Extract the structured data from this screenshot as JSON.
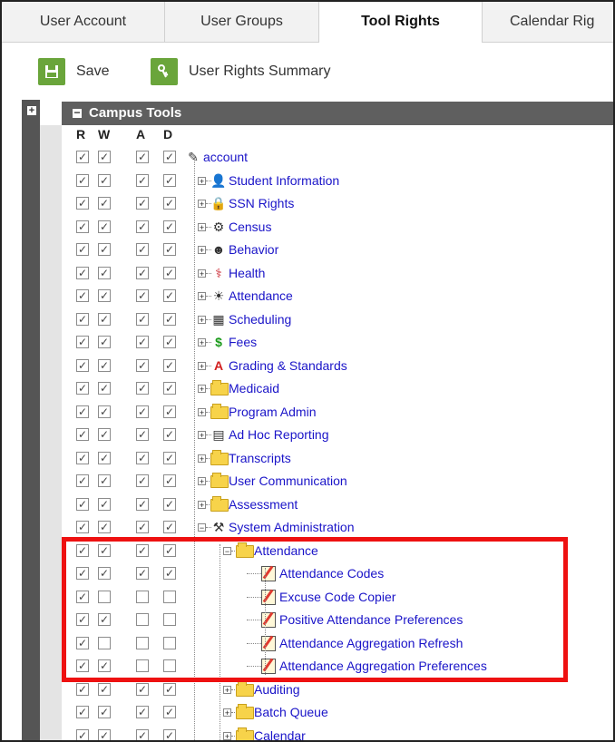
{
  "tabs": [
    "User Account",
    "User Groups",
    "Tool Rights",
    "Calendar Rig"
  ],
  "active_tab": "Tool Rights",
  "toolbar": {
    "save_label": "Save",
    "summary_label": "User Rights Summary"
  },
  "panel": {
    "title": "Campus Tools"
  },
  "columns": [
    "R",
    "W",
    "A",
    "D"
  ],
  "checked_color": "#444444",
  "highlight_color": "#ee1111",
  "rows": [
    {
      "label": "account",
      "icon": "account-edit-icon",
      "checks": [
        1,
        1,
        1,
        1
      ]
    },
    {
      "label": "Student Information",
      "icon": "student-icon",
      "checks": [
        1,
        1,
        1,
        1
      ]
    },
    {
      "label": "SSN Rights",
      "icon": "lock-icon",
      "checks": [
        1,
        1,
        1,
        1
      ]
    },
    {
      "label": "Census",
      "icon": "census-icon",
      "checks": [
        1,
        1,
        1,
        1
      ]
    },
    {
      "label": "Behavior",
      "icon": "behavior-icon",
      "checks": [
        1,
        1,
        1,
        1
      ]
    },
    {
      "label": "Health",
      "icon": "health-icon",
      "checks": [
        1,
        1,
        1,
        1
      ]
    },
    {
      "label": "Attendance",
      "icon": "attendance-icon",
      "checks": [
        1,
        1,
        1,
        1
      ]
    },
    {
      "label": "Scheduling",
      "icon": "scheduling-icon",
      "checks": [
        1,
        1,
        1,
        1
      ]
    },
    {
      "label": "Fees",
      "icon": "dollar-icon",
      "checks": [
        1,
        1,
        1,
        1
      ]
    },
    {
      "label": "Grading & Standards",
      "icon": "grading-icon",
      "checks": [
        1,
        1,
        1,
        1
      ]
    },
    {
      "label": "Medicaid",
      "icon": "folder-icon",
      "checks": [
        1,
        1,
        1,
        1
      ]
    },
    {
      "label": "Program Admin",
      "icon": "folder-icon",
      "checks": [
        1,
        1,
        1,
        1
      ]
    },
    {
      "label": "Ad Hoc Reporting",
      "icon": "report-icon",
      "checks": [
        1,
        1,
        1,
        1
      ]
    },
    {
      "label": "Transcripts",
      "icon": "folder-icon",
      "checks": [
        1,
        1,
        1,
        1
      ]
    },
    {
      "label": "User Communication",
      "icon": "folder-icon",
      "checks": [
        1,
        1,
        1,
        1
      ]
    },
    {
      "label": "Assessment",
      "icon": "folder-icon",
      "checks": [
        1,
        1,
        1,
        1
      ]
    },
    {
      "label": "System Administration",
      "icon": "system-admin-icon",
      "checks": [
        1,
        1,
        1,
        1
      ]
    },
    {
      "label": "Attendance",
      "icon": "folder-icon",
      "checks": [
        1,
        1,
        1,
        1
      ]
    },
    {
      "label": "Attendance Codes",
      "icon": "edit-note-icon",
      "checks": [
        1,
        1,
        1,
        1
      ]
    },
    {
      "label": "Excuse Code Copier",
      "icon": "edit-note-icon",
      "checks": [
        1,
        0,
        0,
        0
      ]
    },
    {
      "label": "Positive Attendance Preferences",
      "icon": "edit-note-icon",
      "checks": [
        1,
        1,
        0,
        0
      ]
    },
    {
      "label": "Attendance Aggregation Refresh",
      "icon": "edit-note-icon",
      "checks": [
        1,
        0,
        0,
        0
      ]
    },
    {
      "label": "Attendance Aggregation Preferences",
      "icon": "edit-note-icon",
      "checks": [
        1,
        1,
        0,
        0
      ]
    },
    {
      "label": "Auditing",
      "icon": "folder-icon",
      "checks": [
        1,
        1,
        1,
        1
      ]
    },
    {
      "label": "Batch Queue",
      "icon": "folder-icon",
      "checks": [
        1,
        1,
        1,
        1
      ]
    },
    {
      "label": "Calendar",
      "icon": "folder-icon",
      "checks": [
        1,
        1,
        1,
        1
      ]
    }
  ]
}
